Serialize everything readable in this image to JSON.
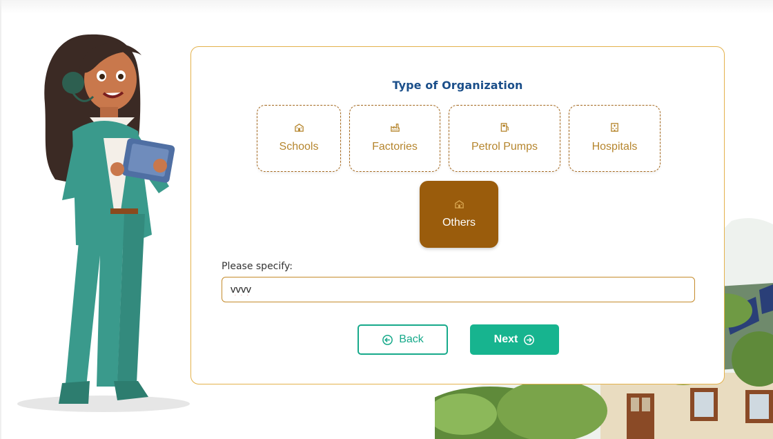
{
  "form": {
    "title": "Type of Organization",
    "options": [
      {
        "label": "Schools",
        "icon": "school-icon",
        "selected": false
      },
      {
        "label": "Factories",
        "icon": "factory-icon",
        "selected": false
      },
      {
        "label": "Petrol Pumps",
        "icon": "fuel-pump-icon",
        "selected": false
      },
      {
        "label": "Hospitals",
        "icon": "hospital-icon",
        "selected": false
      },
      {
        "label": "Others",
        "icon": "building-icon",
        "selected": true
      }
    ],
    "specify_label": "Please specify:",
    "specify_value": "vvvv"
  },
  "buttons": {
    "back_label": "Back",
    "next_label": "Next"
  },
  "colors": {
    "accent_gold": "#b5852d",
    "selected_brown": "#9a5c0c",
    "title_blue": "#1b4f8a",
    "primary_green": "#17b48f"
  }
}
